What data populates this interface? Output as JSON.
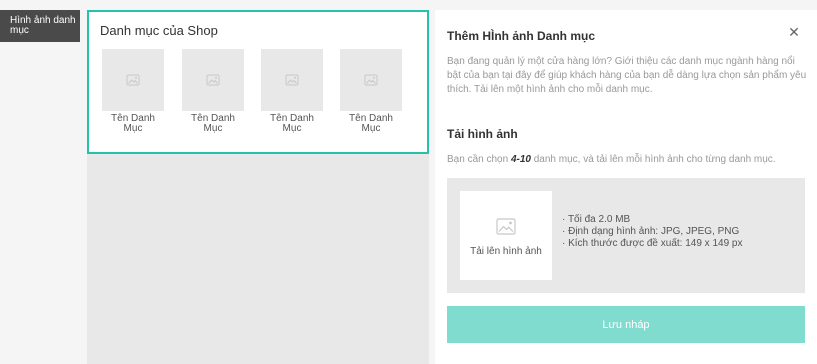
{
  "sidebar": {
    "tag_label": "Hình ảnh danh mục"
  },
  "editor": {
    "title": "Danh mục của Shop",
    "categories": [
      {
        "label": "Tên Danh Mục",
        "icon": "image-placeholder-icon"
      },
      {
        "label": "Tên Danh Mục",
        "icon": "image-placeholder-icon"
      },
      {
        "label": "Tên Danh Mục",
        "icon": "image-placeholder-icon"
      },
      {
        "label": "Tên Danh Mục",
        "icon": "image-placeholder-icon"
      }
    ]
  },
  "panel": {
    "title": "Thêm HÌnh ảnh Danh mục",
    "close_icon": "close-icon",
    "intro": "Bạn đang quản lý một cửa hàng lớn? Giới thiệu các danh mục ngành hàng nổi bật của bạn tại đây để giúp khách hàng của bạn dễ dàng lựa chọn sản phẩm yêu thích. Tải lên một hình ảnh cho mỗi danh mục.",
    "upload_title": "Tải hình ảnh",
    "upload_note_prefix": "Bạn cần chọn ",
    "upload_note_emphasis": "4-10",
    "upload_note_suffix": " danh mục, và tải lên mỗi hình ảnh cho từng danh mục.",
    "upload_button_label": "Tải lên hình ảnh",
    "upload_rules": [
      "Tối đa 2.0 MB",
      "Định dạng hình ảnh: JPG, JPEG, PNG",
      "Kích thước được đề xuất: 149 x 149 px"
    ],
    "save_label": "Lưu nháp"
  },
  "colors": {
    "accent": "#26c1aa",
    "save_button": "#7fdccf",
    "side_tag_bg": "#4a4a4a",
    "placeholder_bg": "#e8e8e8"
  }
}
